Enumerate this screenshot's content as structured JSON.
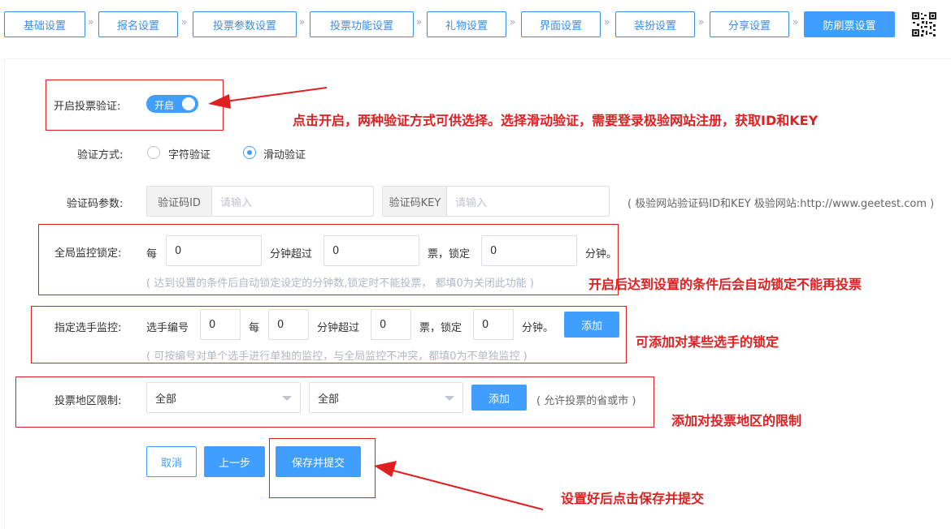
{
  "tabs": [
    {
      "label": "基础设置"
    },
    {
      "label": "报名设置"
    },
    {
      "label": "投票参数设置"
    },
    {
      "label": "投票功能设置"
    },
    {
      "label": "礼物设置"
    },
    {
      "label": "界面设置"
    },
    {
      "label": "装扮设置"
    },
    {
      "label": "分享设置"
    },
    {
      "label": "防刷票设置",
      "active": true
    }
  ],
  "tab_separator": "»",
  "vote_verify": {
    "label": "开启投票验证:",
    "toggle_text": "开启",
    "enabled": true
  },
  "verify_method": {
    "label": "验证方式:",
    "options": [
      "字符验证",
      "滑动验证"
    ],
    "selected": "滑动验证"
  },
  "captcha_params": {
    "label": "验证码参数:",
    "id_prefix": "验证码ID",
    "id_placeholder": "请输入",
    "key_prefix": "验证码KEY",
    "key_placeholder": "请输入",
    "note": "( 极验网站验证码ID和KEY 极验网站:http://www.geetest.com )"
  },
  "global_lock": {
    "label": "全局监控锁定:",
    "t_every": "每",
    "v1": "0",
    "t_minutes_over": "分钟超过",
    "v2": "0",
    "t_votes_lock": "票，锁定",
    "v3": "0",
    "t_minutes_end": "分钟。",
    "hint": "( 达到设置的条件后自动锁定设定的分钟数,锁定时不能投票， 都填0为关闭此功能 )"
  },
  "player_lock": {
    "label": "指定选手监控:",
    "t_player_no": "选手编号",
    "v_no": "0",
    "t_every": "每",
    "v1": "0",
    "t_minutes_over": "分钟超过",
    "v2": "0",
    "t_votes_lock": "票，锁定",
    "v3": "0",
    "t_minutes_end": "分钟。",
    "add_label": "添加",
    "hint": "( 可按编号对单个选手进行单独的监控，与全局监控不冲突，都填0为不单独监控 )"
  },
  "region_limit": {
    "label": "投票地区限制:",
    "province": "全部",
    "city": "全部",
    "add_label": "添加",
    "hint": "( 允许投票的省或市 )"
  },
  "actions": {
    "cancel": "取消",
    "prev": "上一步",
    "save": "保存并提交"
  },
  "annotations": {
    "a1": "点击开启，两种验证方式可供选择。选择滑动验证，需要登录极验网站注册，获取ID和KEY",
    "a2": "开启后达到设置的条件后会自动锁定不能再投票",
    "a3": "可添加对某些选手的锁定",
    "a4": "添加对投票地区的限制",
    "a5": "设置好后点击保存并提交"
  },
  "colors": {
    "primary": "#409eff",
    "annotation": "#e02020",
    "hint": "#b0b8c4"
  }
}
